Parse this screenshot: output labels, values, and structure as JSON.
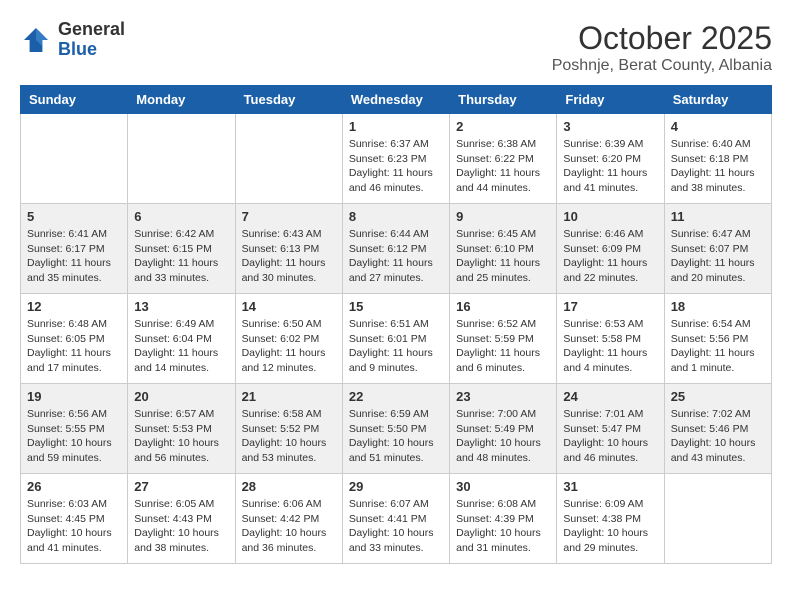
{
  "header": {
    "logo_general": "General",
    "logo_blue": "Blue",
    "month": "October 2025",
    "location": "Poshnje, Berat County, Albania"
  },
  "weekdays": [
    "Sunday",
    "Monday",
    "Tuesday",
    "Wednesday",
    "Thursday",
    "Friday",
    "Saturday"
  ],
  "weeks": [
    [
      {
        "day": "",
        "info": ""
      },
      {
        "day": "",
        "info": ""
      },
      {
        "day": "",
        "info": ""
      },
      {
        "day": "1",
        "info": "Sunrise: 6:37 AM\nSunset: 6:23 PM\nDaylight: 11 hours\nand 46 minutes."
      },
      {
        "day": "2",
        "info": "Sunrise: 6:38 AM\nSunset: 6:22 PM\nDaylight: 11 hours\nand 44 minutes."
      },
      {
        "day": "3",
        "info": "Sunrise: 6:39 AM\nSunset: 6:20 PM\nDaylight: 11 hours\nand 41 minutes."
      },
      {
        "day": "4",
        "info": "Sunrise: 6:40 AM\nSunset: 6:18 PM\nDaylight: 11 hours\nand 38 minutes."
      }
    ],
    [
      {
        "day": "5",
        "info": "Sunrise: 6:41 AM\nSunset: 6:17 PM\nDaylight: 11 hours\nand 35 minutes."
      },
      {
        "day": "6",
        "info": "Sunrise: 6:42 AM\nSunset: 6:15 PM\nDaylight: 11 hours\nand 33 minutes."
      },
      {
        "day": "7",
        "info": "Sunrise: 6:43 AM\nSunset: 6:13 PM\nDaylight: 11 hours\nand 30 minutes."
      },
      {
        "day": "8",
        "info": "Sunrise: 6:44 AM\nSunset: 6:12 PM\nDaylight: 11 hours\nand 27 minutes."
      },
      {
        "day": "9",
        "info": "Sunrise: 6:45 AM\nSunset: 6:10 PM\nDaylight: 11 hours\nand 25 minutes."
      },
      {
        "day": "10",
        "info": "Sunrise: 6:46 AM\nSunset: 6:09 PM\nDaylight: 11 hours\nand 22 minutes."
      },
      {
        "day": "11",
        "info": "Sunrise: 6:47 AM\nSunset: 6:07 PM\nDaylight: 11 hours\nand 20 minutes."
      }
    ],
    [
      {
        "day": "12",
        "info": "Sunrise: 6:48 AM\nSunset: 6:05 PM\nDaylight: 11 hours\nand 17 minutes."
      },
      {
        "day": "13",
        "info": "Sunrise: 6:49 AM\nSunset: 6:04 PM\nDaylight: 11 hours\nand 14 minutes."
      },
      {
        "day": "14",
        "info": "Sunrise: 6:50 AM\nSunset: 6:02 PM\nDaylight: 11 hours\nand 12 minutes."
      },
      {
        "day": "15",
        "info": "Sunrise: 6:51 AM\nSunset: 6:01 PM\nDaylight: 11 hours\nand 9 minutes."
      },
      {
        "day": "16",
        "info": "Sunrise: 6:52 AM\nSunset: 5:59 PM\nDaylight: 11 hours\nand 6 minutes."
      },
      {
        "day": "17",
        "info": "Sunrise: 6:53 AM\nSunset: 5:58 PM\nDaylight: 11 hours\nand 4 minutes."
      },
      {
        "day": "18",
        "info": "Sunrise: 6:54 AM\nSunset: 5:56 PM\nDaylight: 11 hours\nand 1 minute."
      }
    ],
    [
      {
        "day": "19",
        "info": "Sunrise: 6:56 AM\nSunset: 5:55 PM\nDaylight: 10 hours\nand 59 minutes."
      },
      {
        "day": "20",
        "info": "Sunrise: 6:57 AM\nSunset: 5:53 PM\nDaylight: 10 hours\nand 56 minutes."
      },
      {
        "day": "21",
        "info": "Sunrise: 6:58 AM\nSunset: 5:52 PM\nDaylight: 10 hours\nand 53 minutes."
      },
      {
        "day": "22",
        "info": "Sunrise: 6:59 AM\nSunset: 5:50 PM\nDaylight: 10 hours\nand 51 minutes."
      },
      {
        "day": "23",
        "info": "Sunrise: 7:00 AM\nSunset: 5:49 PM\nDaylight: 10 hours\nand 48 minutes."
      },
      {
        "day": "24",
        "info": "Sunrise: 7:01 AM\nSunset: 5:47 PM\nDaylight: 10 hours\nand 46 minutes."
      },
      {
        "day": "25",
        "info": "Sunrise: 7:02 AM\nSunset: 5:46 PM\nDaylight: 10 hours\nand 43 minutes."
      }
    ],
    [
      {
        "day": "26",
        "info": "Sunrise: 6:03 AM\nSunset: 4:45 PM\nDaylight: 10 hours\nand 41 minutes."
      },
      {
        "day": "27",
        "info": "Sunrise: 6:05 AM\nSunset: 4:43 PM\nDaylight: 10 hours\nand 38 minutes."
      },
      {
        "day": "28",
        "info": "Sunrise: 6:06 AM\nSunset: 4:42 PM\nDaylight: 10 hours\nand 36 minutes."
      },
      {
        "day": "29",
        "info": "Sunrise: 6:07 AM\nSunset: 4:41 PM\nDaylight: 10 hours\nand 33 minutes."
      },
      {
        "day": "30",
        "info": "Sunrise: 6:08 AM\nSunset: 4:39 PM\nDaylight: 10 hours\nand 31 minutes."
      },
      {
        "day": "31",
        "info": "Sunrise: 6:09 AM\nSunset: 4:38 PM\nDaylight: 10 hours\nand 29 minutes."
      },
      {
        "day": "",
        "info": ""
      }
    ]
  ]
}
